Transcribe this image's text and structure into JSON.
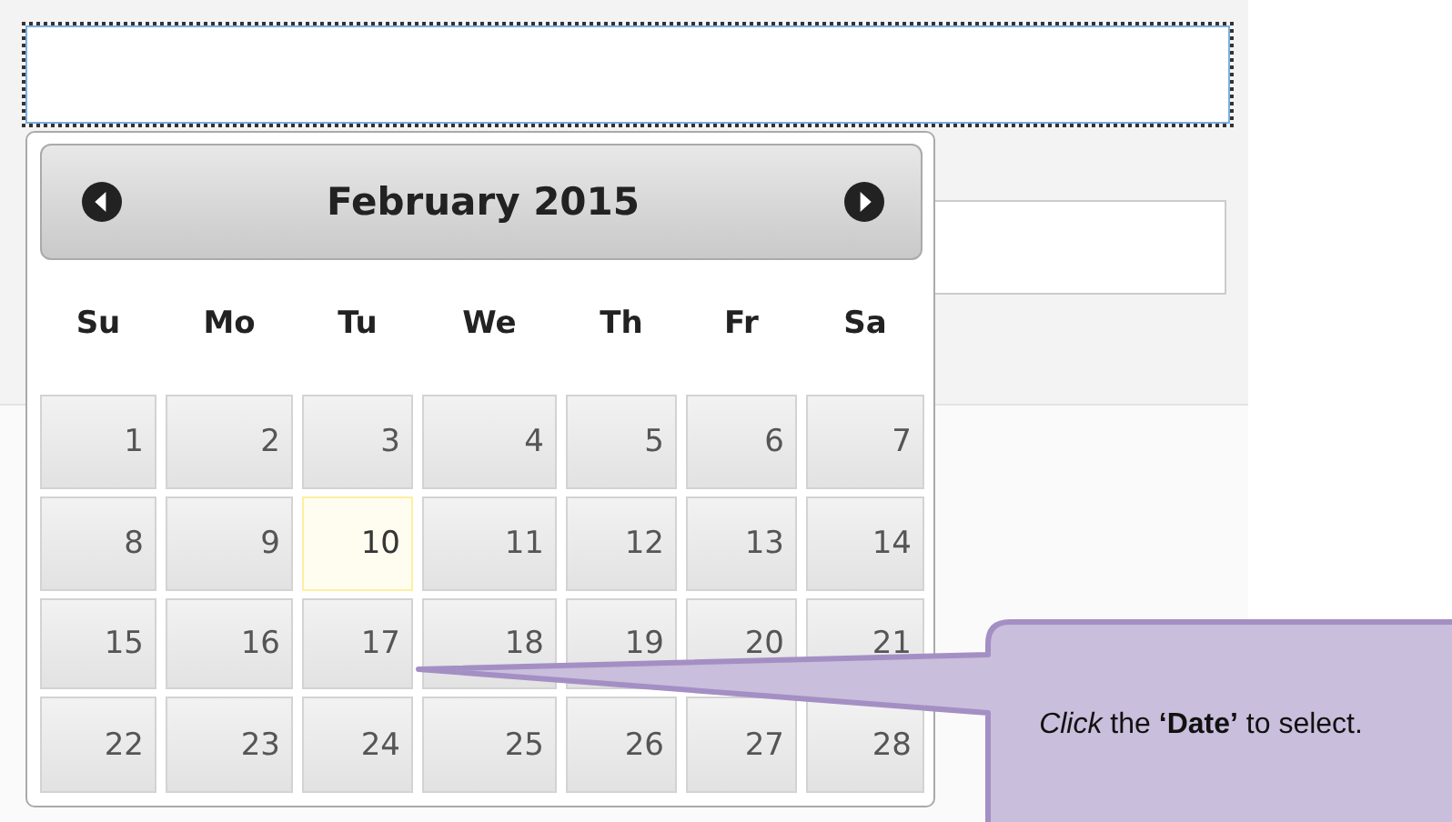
{
  "fields": [
    {
      "focused": true
    },
    {
      "focused": false
    }
  ],
  "datepicker": {
    "title": "February 2015",
    "weekdays": [
      "Su",
      "Mo",
      "Tu",
      "We",
      "Th",
      "Fr",
      "Sa"
    ],
    "weeks": [
      [
        {
          "day": "1",
          "today": false
        },
        {
          "day": "2",
          "today": false
        },
        {
          "day": "3",
          "today": false
        },
        {
          "day": "4",
          "today": false
        },
        {
          "day": "5",
          "today": false
        },
        {
          "day": "6",
          "today": false
        },
        {
          "day": "7",
          "today": false
        }
      ],
      [
        {
          "day": "8",
          "today": false
        },
        {
          "day": "9",
          "today": false
        },
        {
          "day": "10",
          "today": true
        },
        {
          "day": "11",
          "today": false
        },
        {
          "day": "12",
          "today": false
        },
        {
          "day": "13",
          "today": false
        },
        {
          "day": "14",
          "today": false
        }
      ],
      [
        {
          "day": "15",
          "today": false
        },
        {
          "day": "16",
          "today": false
        },
        {
          "day": "17",
          "today": false
        },
        {
          "day": "18",
          "today": false
        },
        {
          "day": "19",
          "today": false
        },
        {
          "day": "20",
          "today": false
        },
        {
          "day": "21",
          "today": false
        }
      ],
      [
        {
          "day": "22",
          "today": false
        },
        {
          "day": "23",
          "today": false
        },
        {
          "day": "24",
          "today": false
        },
        {
          "day": "25",
          "today": false
        },
        {
          "day": "26",
          "today": false
        },
        {
          "day": "27",
          "today": false
        },
        {
          "day": "28",
          "today": false
        }
      ]
    ]
  },
  "callout": {
    "text": "*Click* the **‘Date’** to select."
  }
}
